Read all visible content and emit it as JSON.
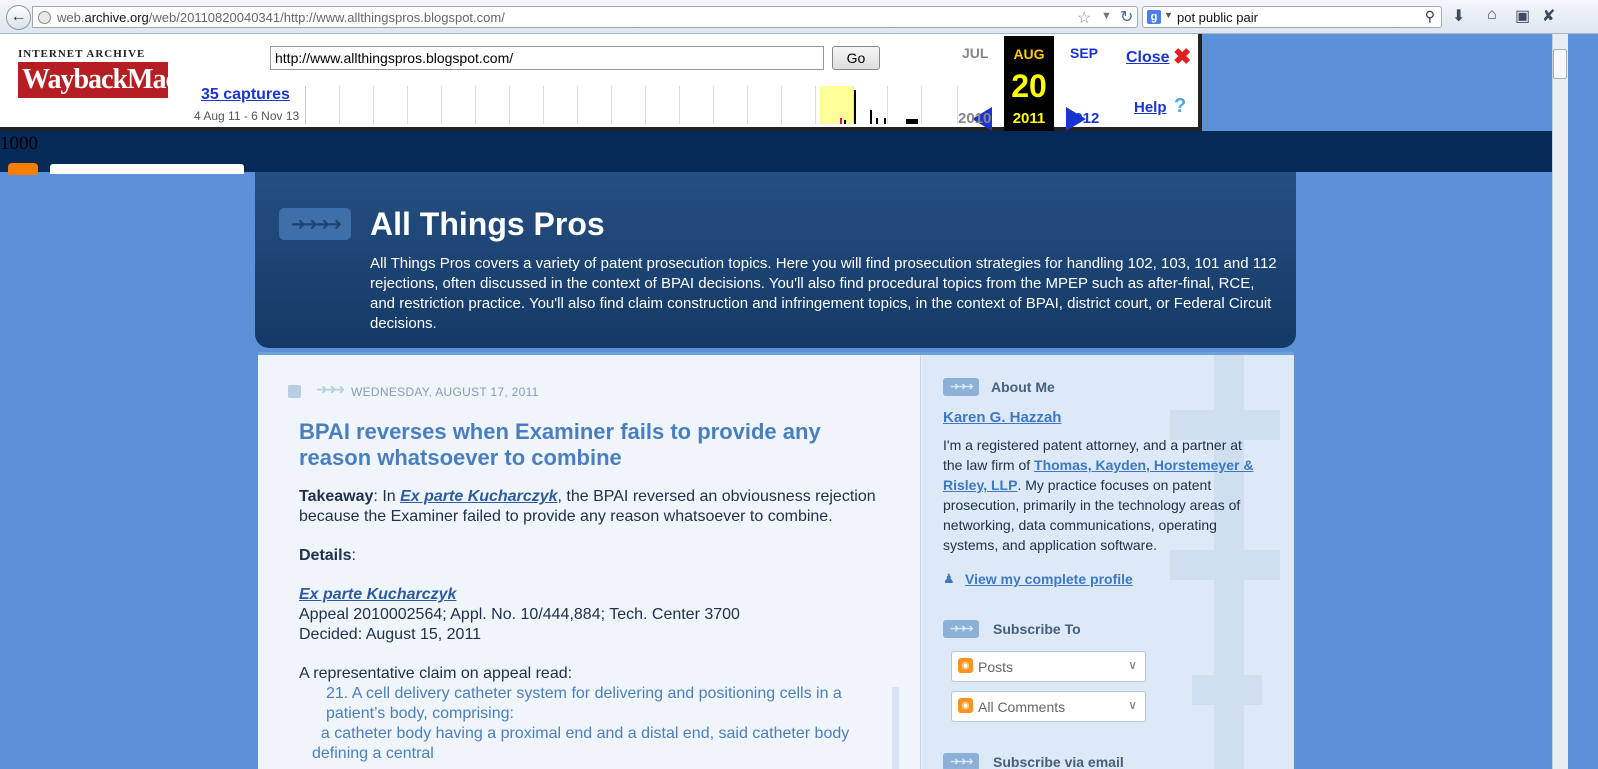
{
  "browser": {
    "url_prefix": "web.",
    "url_host": "archive.org",
    "url_path": "/web/20110820040341/http://www.allthingspros.blogspot.com/",
    "search_text": "pot public pair",
    "search_engine_letter": "g"
  },
  "wayback": {
    "logo_top": "INTERNET ARCHIVE",
    "logo_main": "WaybackMachine",
    "url_value": "http://www.allthingspros.blogspot.com/",
    "go_label": "Go",
    "captures_label": "35 captures",
    "range_label": "4 Aug 11 - 6 Nov 13",
    "prev_month": "JUL",
    "cur_month": "AUG",
    "next_month": "SEP",
    "cur_day": "20",
    "prev_year": "2010",
    "cur_year": "2011",
    "next_year": "2012",
    "close_label": "Close",
    "help_label": "Help"
  },
  "stray_text": "1000",
  "blog": {
    "title": "All Things Pros",
    "description": "All Things Pros covers a variety of patent prosecution topics. Here you will find prosecution strategies for handling 102, 103, 101 and 112 rejections, often discussed in the context of BPAI decisions. You'll also find procedural topics from the MPEP such as after-final, RCE, and restriction practice. You'll also find claim construction and infringement topics, in the context of BPAI, district court, or Federal Circuit decisions."
  },
  "post": {
    "date": "WEDNESDAY, AUGUST 17, 2011",
    "title": "BPAI reverses when Examiner fails to provide any reason whatsoever to combine",
    "takeaway_label": "Takeaway",
    "takeaway_in": ": In ",
    "case_name": "Ex parte Kucharczyk",
    "takeaway_rest": ", the BPAI reversed an obviousness rejection because the Examiner failed to provide any reason whatsoever to combine.",
    "details_label": "Details",
    "details_colon": ":",
    "appeal_line": "Appeal 2010002564; Appl. No. 10/444,884; Tech. Center 3700",
    "decided_line": "Decided:  August 15, 2011",
    "claim_intro": "A representative claim on appeal read:",
    "claim_line1": "21. A cell delivery catheter system for delivering and positioning cells in a patient’s body, comprising:",
    "claim_line2": "a catheter body having a proximal end and a distal end, said catheter body defining a central"
  },
  "sidebar": {
    "about_heading": "About Me",
    "profile_name": "Karen G. Hazzah",
    "bio_before": "I'm a registered patent attorney, and a partner at the law firm of ",
    "firm_name": "Thomas, Kayden, Horstemeyer & Risley, LLP",
    "bio_after": ". My practice focuses on patent prosecution, primarily in the technology areas of networking, data communications, operating systems, and application software.",
    "profile_link": "View my complete profile",
    "subscribe_heading": "Subscribe To",
    "subscribe_options": [
      "Posts",
      "All Comments"
    ],
    "next_heading": "Subscribe via email"
  }
}
